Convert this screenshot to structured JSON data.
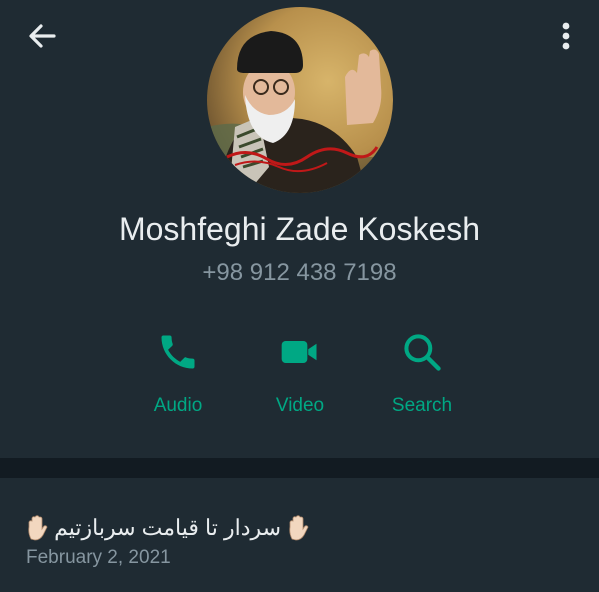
{
  "header": {
    "back_icon": "arrow-left-icon",
    "menu_icon": "more-vertical-icon"
  },
  "contact": {
    "name": "Moshfeghi Zade Koskesh",
    "phone": "+98 912 438 7198"
  },
  "actions": [
    {
      "label": "Audio",
      "icon": "phone-icon"
    },
    {
      "label": "Video",
      "icon": "video-camera-icon"
    },
    {
      "label": "Search",
      "icon": "search-icon"
    }
  ],
  "about": {
    "text": "سردار تا قیامت سربازتیم",
    "date": "February 2, 2021",
    "emoji": "raised-hand-icon"
  },
  "colors": {
    "accent": "#00a884",
    "background": "#121b22",
    "panel": "#1f2b33",
    "primary_text": "#e9edef",
    "secondary_text": "#8696a0"
  }
}
